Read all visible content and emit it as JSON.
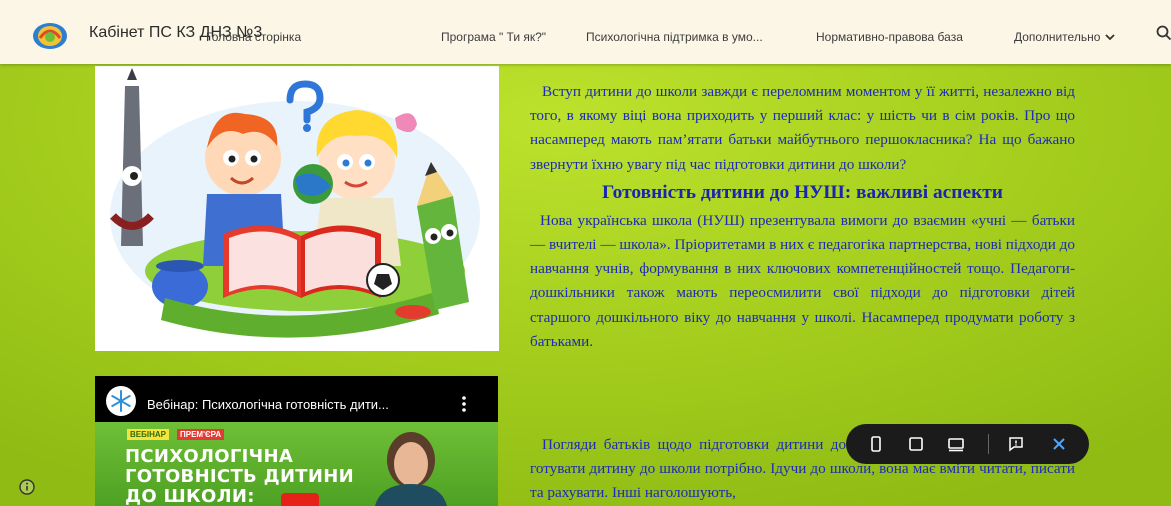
{
  "header": {
    "site_title": "Кабінет ПС КЗ ДНЗ №3",
    "nav": [
      {
        "label": "Головна сторінка"
      },
      {
        "label": "Програма \" Ти як?\""
      },
      {
        "label": "Психологічна підтримка в умо..."
      },
      {
        "label": "Нормативно-правова база"
      },
      {
        "label": "Дополнительно"
      }
    ],
    "logo_icon": "site-logo",
    "search_icon": "search-icon",
    "more_icon": "chevron-down-icon"
  },
  "video": {
    "title": "Вебінар: Психологічна готовність дити...",
    "tag_webinar": "ВЕБІНАР",
    "tag_premiere": "ПРЕМ'ЄРА",
    "lines": [
      "ПСИХОЛОГІЧНА",
      "ГОТОВНІСТЬ ДИТИНИ",
      "ДО ШКОЛИ:"
    ],
    "channel_icon": "snowflake-icon",
    "menu_icon": "more-vert-icon"
  },
  "content": {
    "intro": "Вступ дитини до школи завжди є переломним моментом у її житті, незалежно від того, в якому віці вона приходить у перший клас: у шість чи в сім років. Про що насамперед мають пам’ятати батьки майбутнього першокласника? На що бажано звернути їхню увагу під час підготовки дитини до школи?",
    "heading": "Готовність дитини до НУШ: важливі аспекти",
    "para2": "Нова українська школа (НУШ) презентувала вимоги до взаємин «учні — батьки — вчителі — школа». Пріоритетами в них є педагогіка партнерства, нові підходи до навчання учнів, формування в них ключових компетенційностей тощо. Педагоги-дошкільники також мають переосмилити свої підходи до підготовки дітей старшого дошкільного віку до навчання у школі. Насамперед продумати роботу з батьками.",
    "para3": "Погляди батьків щодо підготовки дитини до школи різні. Одні вважають, що готувати дитину до школи потрібно. Ідучи до школи, вона має вміти читати, писати та рахувати. Інші наголошують,"
  },
  "toolbar": {
    "icons": [
      "phone-view-icon",
      "tablet-view-icon",
      "desktop-view-icon",
      "feedback-icon",
      "close-icon"
    ]
  },
  "colors": {
    "background": "#a6cf1c",
    "header_bg": "#fbf6e6",
    "text_blue": "#1d2bb8"
  }
}
